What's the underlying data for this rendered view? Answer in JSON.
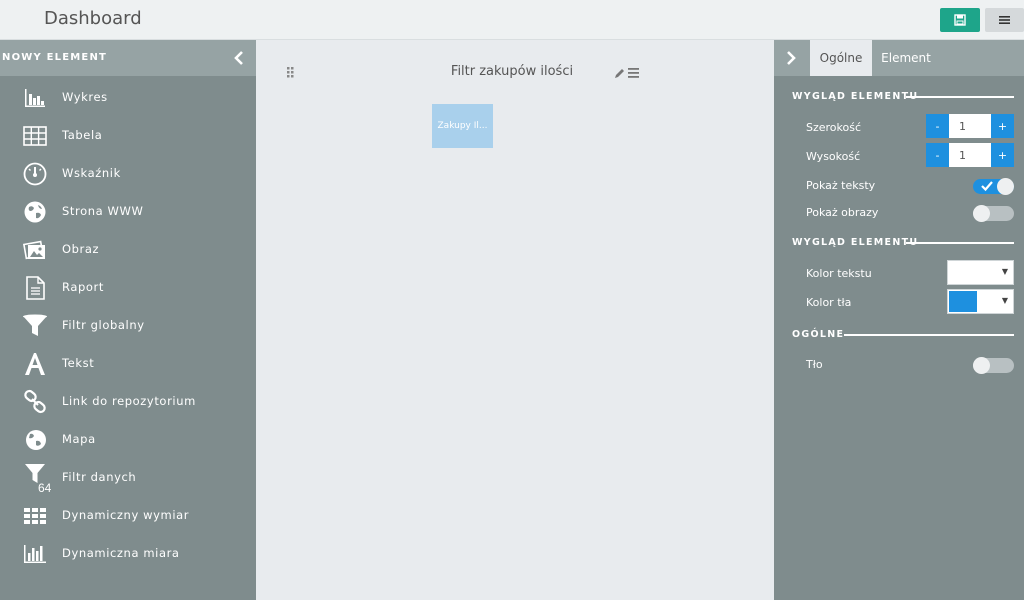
{
  "header": {
    "title": "Dashboard",
    "save_icon": "floppy-disk-icon",
    "menu_icon": "hamburger-menu-icon"
  },
  "left_panel": {
    "title": "NOWY ELEMENT",
    "collapse_icon": "chevron-left-icon",
    "items": [
      {
        "label": "Wykres",
        "icon": "bar-chart-icon"
      },
      {
        "label": "Tabela",
        "icon": "table-grid-icon"
      },
      {
        "label": "Wskaźnik",
        "icon": "gauge-icon"
      },
      {
        "label": "Strona WWW",
        "icon": "globe-icon"
      },
      {
        "label": "Obraz",
        "icon": "image-icon"
      },
      {
        "label": "Raport",
        "icon": "document-icon"
      },
      {
        "label": "Filtr globalny",
        "icon": "funnel-icon"
      },
      {
        "label": "Tekst",
        "icon": "letter-a-icon"
      },
      {
        "label": "Link do repozytorium",
        "icon": "chain-link-icon"
      },
      {
        "label": "Mapa",
        "icon": "earth-icon"
      },
      {
        "label": "Filtr danych",
        "icon": "funnel-64-icon",
        "icon_text": "64"
      },
      {
        "label": "Dynamiczny wymiar",
        "icon": "grid-icon"
      },
      {
        "label": "Dynamiczna miara",
        "icon": "column-chart-icon"
      }
    ]
  },
  "canvas": {
    "widget_title": "Filtr zakupów ilości",
    "chip_label": "Zakupy Il..."
  },
  "right_panel": {
    "expand_icon": "chevron-right-icon",
    "tabs": [
      {
        "label": "Ogólne",
        "active": true
      },
      {
        "label": "Element",
        "active": false
      }
    ],
    "sections": [
      {
        "title": "WYGLĄD ELEMENTU"
      },
      {
        "title": "WYGLĄD ELEMENTU"
      },
      {
        "title": "OGÓLNE"
      }
    ],
    "width": {
      "label": "Szerokość",
      "value": "1",
      "minus": "-",
      "plus": "+"
    },
    "height": {
      "label": "Wysokość",
      "value": "1",
      "minus": "-",
      "plus": "+"
    },
    "show_texts": {
      "label": "Pokaż teksty",
      "on": true
    },
    "show_images": {
      "label": "Pokaż obrazy",
      "on": false
    },
    "text_color": {
      "label": "Kolor tekstu",
      "color": "#ffffff"
    },
    "bg_color": {
      "label": "Kolor tła",
      "color": "#1e90df"
    },
    "background": {
      "label": "Tło",
      "on": false
    }
  },
  "colors": {
    "panel": "#7f8c8d",
    "panel_header": "#96a3a4",
    "accent_blue": "#1e90df",
    "save_green": "#1ea58a"
  }
}
